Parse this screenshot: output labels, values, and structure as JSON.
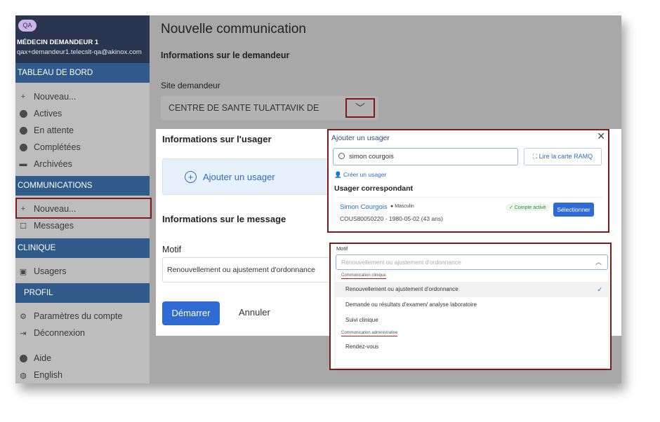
{
  "sidebar": {
    "user": {
      "badge": "QA",
      "role": "MÉDECIN DEMANDEUR 1",
      "email": "qax+demandeur1.telecslt-qa@akinox.com"
    },
    "sections": {
      "dashboard": "TABLEAU DE BORD",
      "communications": "COMMUNICATIONS",
      "clinique": "CLINIQUE",
      "profil": "PROFIL"
    },
    "dashboard_items": [
      "Nouveau...",
      "Actives",
      "En attente",
      "Complétées",
      "Archivées"
    ],
    "communication_items": [
      "Nouveau...",
      "Messages"
    ],
    "clinique_items": [
      "Usagers"
    ],
    "profil_items": [
      "Paramètres du compte",
      "Déconnexion"
    ],
    "footer_items": [
      "Aide",
      "English"
    ]
  },
  "main": {
    "title": "Nouvelle communication",
    "requester_section": "Informations sur le demandeur",
    "site_label": "Site demandeur",
    "site_value": "CENTRE DE SANTE TULATTAVIK DE",
    "usager_section": "Informations sur l'usager",
    "add_usager": "Ajouter un usager",
    "message_section": "Informations sur le message",
    "motif_label": "Motif",
    "motif_value": "Renouvellement ou ajustement d'ordonnance",
    "start_button": "Démarrer",
    "cancel_button": "Annuler"
  },
  "add_usager_popup": {
    "title": "Ajouter un usager",
    "search_value": "simon courgois",
    "ramq_button": "Lire la carte RAMQ",
    "create_link": "Créer un usager",
    "match_title": "Usager correspondant",
    "result": {
      "name": "Simon Courgois",
      "sex": "Masculin",
      "details": "COUS80050220 - 1980-05-02 (43 ans)",
      "status": "Compte activé",
      "select_button": "Sélectionner"
    }
  },
  "motif_popup": {
    "label": "Motif",
    "placeholder": "Renouvellement ou ajustement d'ordonnance",
    "groups": [
      {
        "name": "Communication clinique",
        "options": [
          "Renouvellement ou ajustement d'ordonnance",
          "Demande ou résultats d'examen/ analyse laboratoire",
          "Suivi clinique"
        ]
      },
      {
        "name": "Communication administrative",
        "options": [
          "Rendez-vous"
        ]
      }
    ],
    "selected": "Renouvellement ou ajustement d'ordonnance"
  },
  "colors": {
    "primary": "#2f6bd3",
    "sidebar_section": "#2f5a8a",
    "highlight_border": "#7a1c1c"
  }
}
